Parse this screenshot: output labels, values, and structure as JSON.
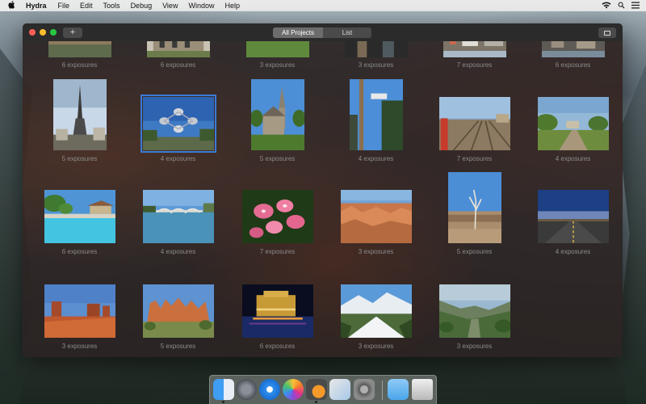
{
  "menubar": {
    "apple_icon": "apple-icon",
    "app_name": "Hydra",
    "items": [
      "File",
      "Edit",
      "Tools",
      "Debug",
      "View",
      "Window",
      "Help"
    ]
  },
  "window": {
    "add_label": "+",
    "tabs": [
      {
        "label": "All Projects",
        "active": true
      },
      {
        "label": "List",
        "active": false
      }
    ]
  },
  "projects": [
    {
      "label": "6 exposures",
      "scene": "partial-brown",
      "partial": true
    },
    {
      "label": "6 exposures",
      "scene": "partial-building",
      "partial": true
    },
    {
      "label": "3 exposures",
      "scene": "partial-green",
      "partial": true
    },
    {
      "label": "3 exposures",
      "scene": "partial-dark",
      "partial": true
    },
    {
      "label": "7 exposures",
      "scene": "partial-city",
      "partial": true
    },
    {
      "label": "6 exposures",
      "scene": "partial-city2",
      "partial": true
    },
    {
      "label": "5 exposures",
      "scene": "eiffel"
    },
    {
      "label": "4 exposures",
      "scene": "atomium",
      "selected": true
    },
    {
      "label": "5 exposures",
      "scene": "church"
    },
    {
      "label": "4 exposures",
      "scene": "pole"
    },
    {
      "label": "7 exposures",
      "scene": "railway"
    },
    {
      "label": "4 exposures",
      "scene": "park"
    },
    {
      "label": "6 exposures",
      "scene": "pool"
    },
    {
      "label": "4 exposures",
      "scene": "bridge"
    },
    {
      "label": "7 exposures",
      "scene": "flowers"
    },
    {
      "label": "3 exposures",
      "scene": "canyon"
    },
    {
      "label": "5 exposures",
      "scene": "deadtree"
    },
    {
      "label": "4 exposures",
      "scene": "road"
    },
    {
      "label": "3 exposures",
      "scene": "monument"
    },
    {
      "label": "5 exposures",
      "scene": "hoodoos"
    },
    {
      "label": "6 exposures",
      "scene": "bellagio"
    },
    {
      "label": "3 exposures",
      "scene": "snow"
    },
    {
      "label": "3 exposures",
      "scene": "valley"
    }
  ],
  "dock": {
    "icons": [
      "finder-icon",
      "launchpad-icon",
      "safari-icon",
      "photos-icon",
      "hydra-icon",
      "preview-icon",
      "system-preferences-icon",
      "downloads-folder-icon",
      "trash-icon"
    ]
  }
}
